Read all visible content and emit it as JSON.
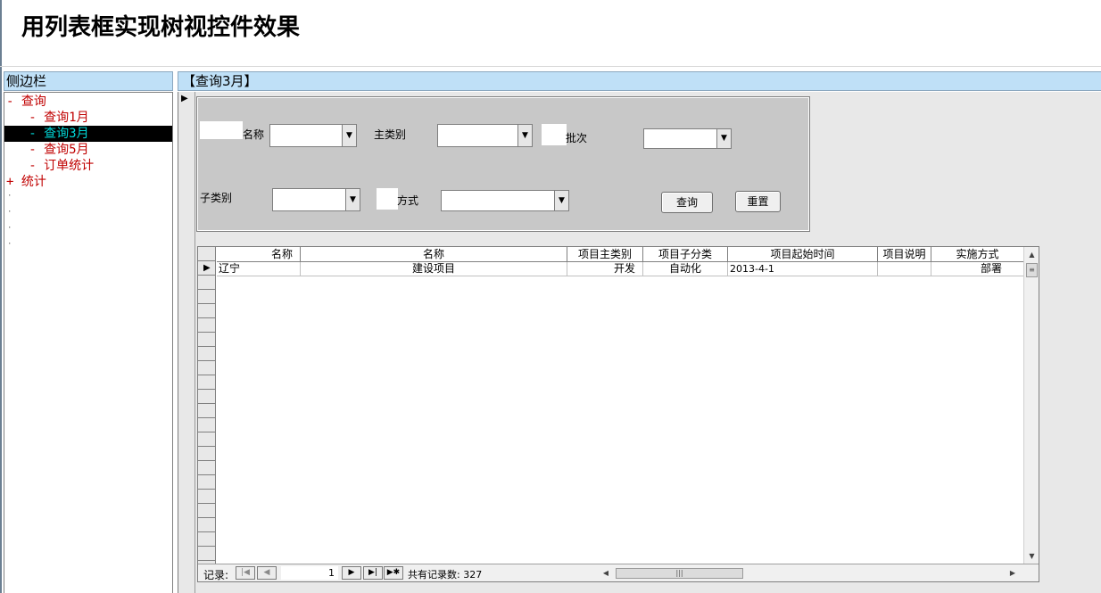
{
  "app": {
    "title": "用列表框实现树视控件效果"
  },
  "sidebar": {
    "header": "侧边栏",
    "items": [
      {
        "label": "- 查询",
        "selected": false
      },
      {
        "label": "   - 查询1月",
        "selected": false
      },
      {
        "label": "   - 查询3月",
        "selected": true
      },
      {
        "label": "   - 查询5月",
        "selected": false
      },
      {
        "label": "   - 订单统计",
        "selected": false
      },
      {
        "label": "+ 统计",
        "selected": false
      }
    ],
    "colors": {
      "item": "#c00000",
      "selected_bg": "#000000",
      "selected_text": "#00d8d8",
      "header_bg": "#bfe0f7"
    }
  },
  "main": {
    "header": "【查询3月】",
    "filter": {
      "name_label": "名称",
      "main_category_label": "主类别",
      "batch_label": "批次",
      "sub_category_label": "子类别",
      "method_label": "方式",
      "query_button": "查询",
      "reset_button": "重置"
    },
    "grid": {
      "columns": [
        "名称",
        "名称",
        "项目主类别",
        "项目子分类",
        "项目起始时间",
        "项目说明",
        "实施方式"
      ],
      "rows": [
        [
          "辽宁",
          "建设项目",
          "开发",
          "自动化",
          "2013-4-1",
          "",
          "部署"
        ]
      ]
    },
    "navigator": {
      "label": "记录:",
      "current": "1",
      "total_text": "共有记录数: 327",
      "icons": [
        "first-record-icon",
        "previous-record-icon",
        "next-record-icon",
        "last-record-icon",
        "new-record-icon"
      ]
    }
  }
}
